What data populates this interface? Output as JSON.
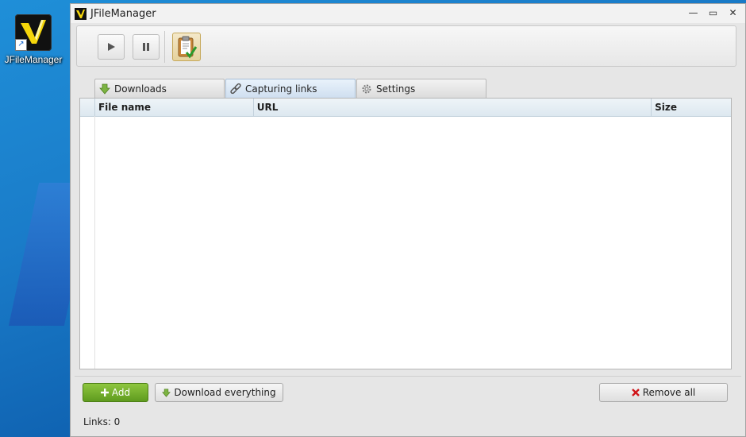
{
  "desktop": {
    "icon_label": "JFileManager"
  },
  "window": {
    "title": "JFileManager",
    "controls": {
      "minimize": "—",
      "maximize": "▭",
      "close": "✕"
    }
  },
  "toolbar": {
    "buttons": [
      {
        "name": "play",
        "icon": "play-icon"
      },
      {
        "name": "pause",
        "icon": "pause-icon"
      },
      {
        "name": "clipboard-monitor",
        "icon": "clipboard-check-icon",
        "active": true
      }
    ]
  },
  "tabs": [
    {
      "label": "Downloads",
      "icon": "download-arrow-icon",
      "selected": false
    },
    {
      "label": "Capturing links",
      "icon": "chain-link-icon",
      "selected": true
    },
    {
      "label": "Settings",
      "icon": "gear-icon",
      "selected": false
    }
  ],
  "table": {
    "columns": [
      "File name",
      "URL",
      "Size"
    ],
    "rows": []
  },
  "actions": {
    "add_label": "Add",
    "download_all_label": "Download everything",
    "remove_all_label": "Remove all"
  },
  "status": {
    "links_text": "Links: 0"
  },
  "colors": {
    "accent_green": "#6aa82a",
    "remove_red": "#d0161b",
    "tab_selected": "#d7e6f5"
  }
}
